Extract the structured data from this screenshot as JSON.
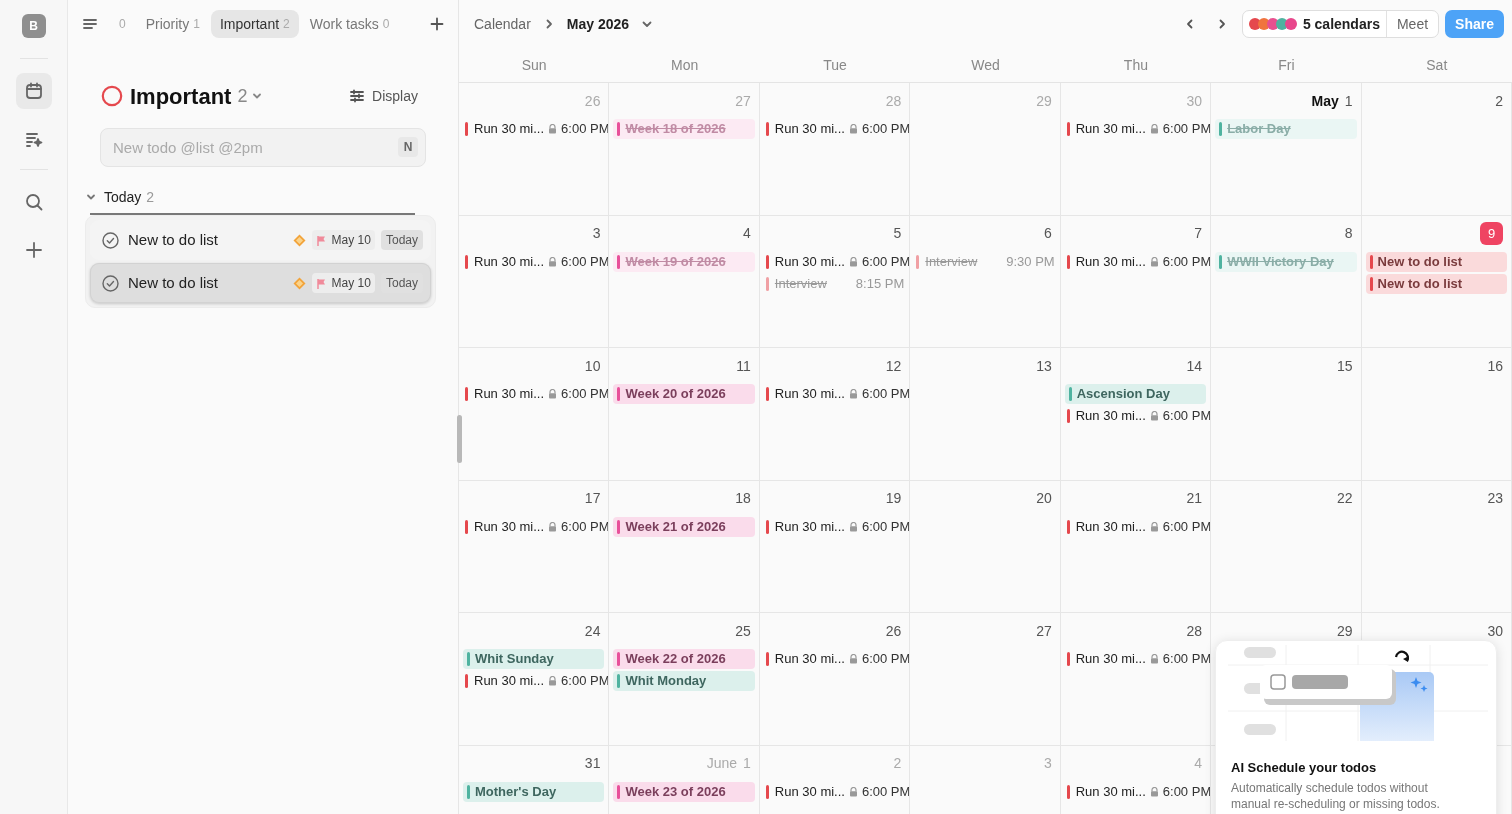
{
  "sidebar": {
    "avatar": "B",
    "items": [
      {
        "kind": "calendar",
        "selected": true
      },
      {
        "kind": "planner",
        "selected": false
      },
      {
        "kind": "search",
        "selected": false
      },
      {
        "kind": "add",
        "selected": false
      }
    ]
  },
  "list_tabs": [
    {
      "count": "0",
      "selected": false
    },
    {
      "label": "Priority",
      "count": "1",
      "selected": false
    },
    {
      "label": "Important",
      "count": "2",
      "selected": true
    },
    {
      "label": "Work tasks",
      "count": "0",
      "selected": false
    }
  ],
  "list": {
    "title": "Important",
    "count": "2",
    "display_button": "Display",
    "input": {
      "placeholder": "New todo @list @2pm",
      "shortcut": "N"
    },
    "section": {
      "title": "Today",
      "count": "2",
      "expanded": true,
      "todos": [
        {
          "title": "New to do list",
          "date": "May 10",
          "when": "Today",
          "selected": false
        },
        {
          "title": "New to do list",
          "date": "May 10",
          "when": "Today",
          "selected": true
        }
      ]
    }
  },
  "calendar": {
    "breadcrumb": "Calendar",
    "month": "May 2026",
    "calendars_label": "5 calendars",
    "calendar_colors": [
      {
        "color": "#e5484d"
      },
      {
        "color": "#f0743e"
      },
      {
        "color": "#e8508f"
      },
      {
        "color": "#4fb3a0"
      },
      {
        "color": "#e8478c"
      }
    ],
    "meet": "Meet",
    "share": "Share",
    "weekdays": [
      "Sun",
      "Mon",
      "Tue",
      "Wed",
      "Thu",
      "Fri",
      "Sat"
    ],
    "weeks": [
      {
        "days": [
          {
            "date": "26",
            "in_month": false,
            "events": [
              {
                "kind": "timed",
                "title": "Run 30 mi...",
                "time": "6:00 PM",
                "locked": true,
                "done": false,
                "color": "#e5484d"
              }
            ]
          },
          {
            "date": "27",
            "in_month": false,
            "events": [
              {
                "kind": "chip",
                "title": "Week 18 of 2026",
                "done": true,
                "color": "#e8509a"
              }
            ]
          },
          {
            "date": "28",
            "in_month": false,
            "events": [
              {
                "kind": "timed",
                "title": "Run 30 mi...",
                "time": "6:00 PM",
                "locked": true,
                "done": false,
                "color": "#e5484d"
              }
            ]
          },
          {
            "date": "29",
            "in_month": false
          },
          {
            "date": "30",
            "in_month": false,
            "events": [
              {
                "kind": "timed",
                "title": "Run 30 mi...",
                "time": "6:00 PM",
                "locked": true,
                "done": false,
                "color": "#e5484d"
              }
            ]
          },
          {
            "month": "May",
            "date": "1",
            "in_month": true,
            "events": [
              {
                "kind": "chip",
                "title": "Labor Day",
                "done": true,
                "color": "#4fb3a0"
              }
            ]
          },
          {
            "date": "2",
            "in_month": true
          }
        ]
      },
      {
        "days": [
          {
            "date": "3",
            "in_month": true,
            "events": [
              {
                "kind": "timed",
                "title": "Run 30 mi...",
                "time": "6:00 PM",
                "locked": true,
                "done": false,
                "color": "#e5484d"
              }
            ]
          },
          {
            "date": "4",
            "in_month": true,
            "events": [
              {
                "kind": "chip",
                "title": "Week 19 of 2026",
                "done": true,
                "color": "#e8509a"
              }
            ]
          },
          {
            "date": "5",
            "in_month": true,
            "events": [
              {
                "kind": "timed",
                "title": "Run 30 mi...",
                "time": "6:00 PM",
                "locked": true,
                "done": false,
                "color": "#e5484d"
              },
              {
                "kind": "timed",
                "title": "Interview",
                "time": "8:15 PM",
                "locked": false,
                "done": true,
                "color": "#f0a0a4"
              }
            ]
          },
          {
            "date": "6",
            "in_month": true,
            "events": [
              {
                "kind": "timed",
                "title": "Interview",
                "time": "9:30 PM",
                "locked": false,
                "done": true,
                "color": "#f0a0a4"
              }
            ]
          },
          {
            "date": "7",
            "in_month": true,
            "events": [
              {
                "kind": "timed",
                "title": "Run 30 mi...",
                "time": "6:00 PM",
                "locked": true,
                "done": false,
                "color": "#e5484d"
              }
            ]
          },
          {
            "date": "8",
            "in_month": true,
            "events": [
              {
                "kind": "chip",
                "title": "WWII Victory Day",
                "done": true,
                "color": "#4fb3a0"
              }
            ]
          },
          {
            "date": "9",
            "in_month": true,
            "today": true,
            "events": [
              {
                "kind": "chip",
                "title": "New to do list",
                "done": false,
                "color": "#e5484d"
              },
              {
                "kind": "chip",
                "title": "New to do list",
                "done": false,
                "color": "#e5484d"
              }
            ]
          }
        ]
      },
      {
        "days": [
          {
            "date": "10",
            "in_month": true,
            "events": [
              {
                "kind": "timed",
                "title": "Run 30 mi...",
                "time": "6:00 PM",
                "locked": true,
                "done": false,
                "color": "#e5484d"
              }
            ]
          },
          {
            "date": "11",
            "in_month": true,
            "events": [
              {
                "kind": "chip",
                "title": "Week 20 of 2026",
                "done": false,
                "color": "#e8509a"
              }
            ]
          },
          {
            "date": "12",
            "in_month": true,
            "events": [
              {
                "kind": "timed",
                "title": "Run 30 mi...",
                "time": "6:00 PM",
                "locked": true,
                "done": false,
                "color": "#e5484d"
              }
            ]
          },
          {
            "date": "13",
            "in_month": true
          },
          {
            "date": "14",
            "in_month": true,
            "events": [
              {
                "kind": "chip",
                "title": "Ascension Day",
                "done": false,
                "color": "#4fb3a0"
              },
              {
                "kind": "timed",
                "title": "Run 30 mi...",
                "time": "6:00 PM",
                "locked": true,
                "done": false,
                "color": "#e5484d"
              }
            ]
          },
          {
            "date": "15",
            "in_month": true
          },
          {
            "date": "16",
            "in_month": true
          }
        ]
      },
      {
        "days": [
          {
            "date": "17",
            "in_month": true,
            "events": [
              {
                "kind": "timed",
                "title": "Run 30 mi...",
                "time": "6:00 PM",
                "locked": true,
                "done": false,
                "color": "#e5484d"
              }
            ]
          },
          {
            "date": "18",
            "in_month": true,
            "events": [
              {
                "kind": "chip",
                "title": "Week 21 of 2026",
                "done": false,
                "color": "#e8509a"
              }
            ]
          },
          {
            "date": "19",
            "in_month": true,
            "events": [
              {
                "kind": "timed",
                "title": "Run 30 mi...",
                "time": "6:00 PM",
                "locked": true,
                "done": false,
                "color": "#e5484d"
              }
            ]
          },
          {
            "date": "20",
            "in_month": true
          },
          {
            "date": "21",
            "in_month": true,
            "events": [
              {
                "kind": "timed",
                "title": "Run 30 mi...",
                "time": "6:00 PM",
                "locked": true,
                "done": false,
                "color": "#e5484d"
              }
            ]
          },
          {
            "date": "22",
            "in_month": true
          },
          {
            "date": "23",
            "in_month": true
          }
        ]
      },
      {
        "days": [
          {
            "date": "24",
            "in_month": true,
            "events": [
              {
                "kind": "chip",
                "title": "Whit Sunday",
                "done": false,
                "color": "#4fb3a0"
              },
              {
                "kind": "timed",
                "title": "Run 30 mi...",
                "time": "6:00 PM",
                "locked": true,
                "done": false,
                "color": "#e5484d"
              }
            ]
          },
          {
            "date": "25",
            "in_month": true,
            "events": [
              {
                "kind": "chip",
                "title": "Week 22 of 2026",
                "done": false,
                "color": "#e8509a"
              },
              {
                "kind": "chip",
                "title": "Whit Monday",
                "done": false,
                "color": "#4fb3a0"
              }
            ]
          },
          {
            "date": "26",
            "in_month": true,
            "events": [
              {
                "kind": "timed",
                "title": "Run 30 mi...",
                "time": "6:00 PM",
                "locked": true,
                "done": false,
                "color": "#e5484d"
              }
            ]
          },
          {
            "date": "27",
            "in_month": true
          },
          {
            "date": "28",
            "in_month": true,
            "events": [
              {
                "kind": "timed",
                "title": "Run 30 mi...",
                "time": "6:00 PM",
                "locked": true,
                "done": false,
                "color": "#e5484d"
              }
            ]
          },
          {
            "date": "29",
            "in_month": true
          },
          {
            "date": "30",
            "in_month": true
          }
        ]
      },
      {
        "days": [
          {
            "date": "31",
            "in_month": true,
            "events": [
              {
                "kind": "chip",
                "title": "Mother's Day",
                "done": false,
                "color": "#4fb3a0"
              }
            ]
          },
          {
            "month": "June",
            "date": "1",
            "in_month": false,
            "events": [
              {
                "kind": "chip",
                "title": "Week 23 of 2026",
                "done": false,
                "color": "#e8509a"
              }
            ]
          },
          {
            "date": "2",
            "in_month": false,
            "events": [
              {
                "kind": "timed",
                "title": "Run 30 mi...",
                "time": "6:00 PM",
                "locked": true,
                "done": false,
                "color": "#e5484d"
              }
            ]
          },
          {
            "date": "3",
            "in_month": false
          },
          {
            "date": "4",
            "in_month": false,
            "events": [
              {
                "kind": "timed",
                "title": "Run 30 mi...",
                "time": "6:00 PM",
                "locked": true,
                "done": false,
                "color": "#e5484d"
              }
            ]
          }
        ]
      }
    ]
  },
  "promo": {
    "title": "AI Schedule your todos",
    "text": "Automatically schedule todos without manual re-scheduling or missing todos."
  }
}
